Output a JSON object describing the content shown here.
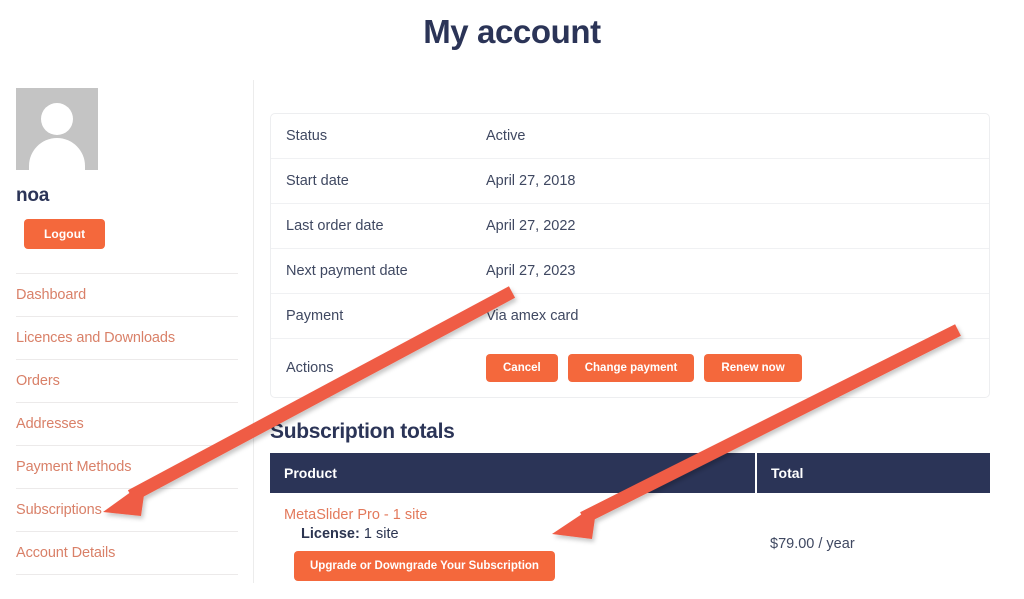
{
  "page": {
    "title": "My account"
  },
  "sidebar": {
    "avatar_alt": "user-avatar",
    "username": "noa",
    "logout_label": "Logout",
    "items": [
      {
        "label": "Dashboard"
      },
      {
        "label": "Licences and Downloads"
      },
      {
        "label": "Orders"
      },
      {
        "label": "Addresses"
      },
      {
        "label": "Payment Methods"
      },
      {
        "label": "Subscriptions"
      },
      {
        "label": "Account Details"
      }
    ]
  },
  "subscription_details": {
    "rows": [
      {
        "label": "Status",
        "value": "Active"
      },
      {
        "label": "Start date",
        "value": "April 27, 2018"
      },
      {
        "label": "Last order date",
        "value": "April 27, 2022"
      },
      {
        "label": "Next payment date",
        "value": "April 27, 2023"
      },
      {
        "label": "Payment",
        "value": "Via amex card"
      }
    ],
    "actions_label": "Actions",
    "actions": [
      {
        "label": "Cancel"
      },
      {
        "label": "Change payment"
      },
      {
        "label": "Renew now"
      }
    ]
  },
  "subscription_totals": {
    "heading": "Subscription totals",
    "columns": {
      "product": "Product",
      "total": "Total"
    },
    "rows": [
      {
        "product_name": "MetaSlider Pro - 1 site",
        "license_label": "License:",
        "license_value": "1 site",
        "upgrade_label": "Upgrade or Downgrade Your Subscription",
        "total": "$79.00 / year"
      }
    ]
  },
  "annotations": {
    "arrow_color": "#ef5b45",
    "arrows": [
      {
        "name": "arrow-to-subscriptions",
        "target": "Subscriptions"
      },
      {
        "name": "arrow-to-upgrade-button",
        "target": "Upgrade or Downgrade Your Subscription"
      }
    ]
  },
  "colors": {
    "accent_orange": "#f4683c",
    "navy": "#2b3457",
    "link_salmon": "#d98068",
    "arrow_red": "#ef5b45"
  }
}
